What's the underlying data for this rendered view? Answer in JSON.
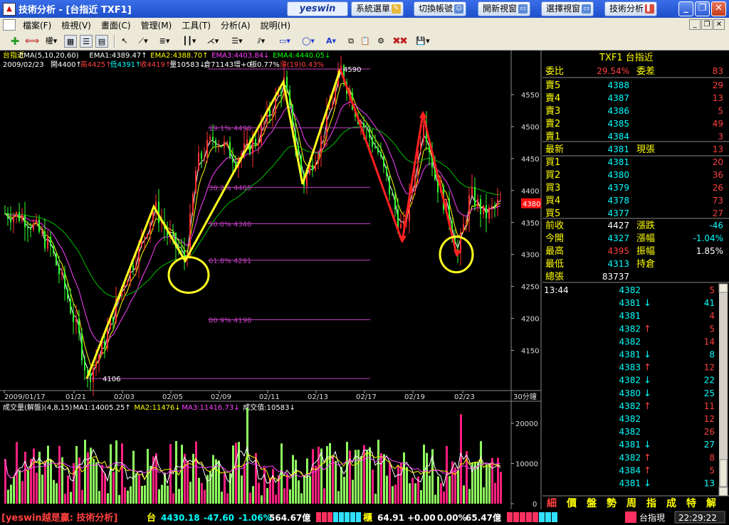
{
  "window": {
    "title": "技術分析 - [台指近 TXF1]",
    "logo": "yeswin",
    "buttons": [
      {
        "label": "系統選單"
      },
      {
        "label": "切換帳號"
      },
      {
        "label": "開新視窗"
      },
      {
        "label": "選擇視窗"
      },
      {
        "label": "技術分析"
      }
    ]
  },
  "menu": [
    "檔案(F)",
    "檢視(V)",
    "畫面(C)",
    "管理(M)",
    "工具(T)",
    "分析(A)",
    "說明(H)"
  ],
  "toolbar": {
    "weight_label": "權"
  },
  "legend": {
    "line1": [
      {
        "text": "台指近",
        "color": "#ffff00"
      },
      {
        "text": "EMA(5,10,20,60)",
        "color": "#ffffff"
      },
      {
        "text": "EMA1:4389.47↑",
        "color": "#ffffff"
      },
      {
        "text": "EMA2:4388.70↑",
        "color": "#ffff00"
      },
      {
        "text": "EMA3:4403.84↓",
        "color": "#ff40ff"
      },
      {
        "text": "EMA4:4440.05↓",
        "color": "#00ff00"
      }
    ],
    "line2": [
      {
        "text": "2009/02/23",
        "color": "#ffffff"
      },
      {
        "text": "開4400↑",
        "color": "#ffffff"
      },
      {
        "text": "高4425↑",
        "color": "#ff4040"
      },
      {
        "text": "低4391↑",
        "color": "#00ffff"
      },
      {
        "text": "收4419↑",
        "color": "#ff4040"
      },
      {
        "text": "量10583↓",
        "color": "#ffffff"
      },
      {
        "text": "倉71143",
        "color": "#ffffff"
      },
      {
        "text": "增+0",
        "color": "#ffffff"
      },
      {
        "text": "振0.77%",
        "color": "#ffffff"
      },
      {
        "text": "漲(19)0.43%",
        "color": "#ff4040"
      }
    ]
  },
  "price_axis": {
    "ticks": [
      4550,
      4500,
      4450,
      4400,
      4350,
      4300,
      4250,
      4200,
      4150
    ],
    "current": "4380"
  },
  "fib_levels": [
    {
      "label": "19.1% 4498",
      "value": 4498
    },
    {
      "label": "38.2% 4405",
      "value": 4405
    },
    {
      "label": "50.0% 4348",
      "value": 4348
    },
    {
      "label": "61.8% 4291",
      "value": 4291
    },
    {
      "label": "80.9% 4198",
      "value": 4198
    }
  ],
  "annotations": {
    "low": "4106",
    "high": "4590"
  },
  "dates": [
    "2009/01/17",
    "01/21",
    "02/03",
    "02/05",
    "02/09",
    "02/11",
    "02/13",
    "02/17",
    "02/19",
    "02/23"
  ],
  "period": "30分鐘",
  "volume_legend": [
    {
      "text": "成交量(解盤)(4,8,15)",
      "color": "#ffffff"
    },
    {
      "text": "MA1:14005.25↑",
      "color": "#ffffff"
    },
    {
      "text": "MA2:11476↓",
      "color": "#ffff00"
    },
    {
      "text": "MA3:11416.73↓",
      "color": "#ff40ff"
    },
    {
      "text": "成交值:10583↓",
      "color": "#ffffff"
    }
  ],
  "volume_axis": [
    "20000",
    "10000",
    "0"
  ],
  "quote": {
    "header": "TXF1 台指近",
    "ratio": {
      "k1": "委比",
      "v1": "29.54%",
      "k2": "委差",
      "v2": "83"
    },
    "asks": [
      {
        "label": "賣5",
        "price": "4388",
        "qty": "29"
      },
      {
        "label": "賣4",
        "price": "4387",
        "qty": "13"
      },
      {
        "label": "賣3",
        "price": "4386",
        "qty": "5"
      },
      {
        "label": "賣2",
        "price": "4385",
        "qty": "49"
      },
      {
        "label": "賣1",
        "price": "4384",
        "qty": "3"
      }
    ],
    "last": {
      "label": "最新",
      "price": "4381",
      "k": "現張",
      "qty": "13"
    },
    "bids": [
      {
        "label": "買1",
        "price": "4381",
        "qty": "20"
      },
      {
        "label": "買2",
        "price": "4380",
        "qty": "36"
      },
      {
        "label": "買3",
        "price": "4379",
        "qty": "26"
      },
      {
        "label": "買4",
        "price": "4378",
        "qty": "73"
      },
      {
        "label": "買5",
        "price": "4377",
        "qty": "27"
      }
    ],
    "stats": [
      {
        "k1": "前收",
        "v1": "4427",
        "k2": "漲跌",
        "v2": "-46"
      },
      {
        "k1": "今開",
        "v1": "4327",
        "k2": "漲幅",
        "v2": "-1.04%"
      },
      {
        "k1": "最高",
        "v1": "4395",
        "k2": "振幅",
        "v2": "1.85%"
      },
      {
        "k1": "最低",
        "v1": "4313",
        "k2": "持倉",
        "v2": ""
      },
      {
        "k1": "總張",
        "v1": "83737",
        "k2": "",
        "v2": ""
      }
    ]
  },
  "ticks": {
    "time": "13:44",
    "rows": [
      {
        "price": "4382",
        "arrow": "",
        "qty": "5"
      },
      {
        "price": "4381",
        "arrow": "↓",
        "qty": "41"
      },
      {
        "price": "4381",
        "arrow": "",
        "qty": "4"
      },
      {
        "price": "4382",
        "arrow": "↑",
        "qty": "5"
      },
      {
        "price": "4382",
        "arrow": "",
        "qty": "14"
      },
      {
        "price": "4381",
        "arrow": "↓",
        "qty": "8"
      },
      {
        "price": "4383",
        "arrow": "↑",
        "qty": "12"
      },
      {
        "price": "4382",
        "arrow": "↓",
        "qty": "22"
      },
      {
        "price": "4380",
        "arrow": "↓",
        "qty": "25"
      },
      {
        "price": "4382",
        "arrow": "↑",
        "qty": "11"
      },
      {
        "price": "4382",
        "arrow": "",
        "qty": "12"
      },
      {
        "price": "4382",
        "arrow": "",
        "qty": "26"
      },
      {
        "price": "4381",
        "arrow": "↓",
        "qty": "27"
      },
      {
        "price": "4382",
        "arrow": "↑",
        "qty": "8"
      },
      {
        "price": "4384",
        "arrow": "↑",
        "qty": "5"
      },
      {
        "price": "4381",
        "arrow": "↓",
        "qty": "13"
      }
    ]
  },
  "quote_tabs": [
    "細",
    "價",
    "盤",
    "勢",
    "周",
    "指",
    "成",
    "特",
    "解"
  ],
  "status": {
    "brand": "[yeswin越是贏: 技術分析]",
    "idx_label": "台",
    "idx_value": "4430.18",
    "idx_change": "-47.60",
    "idx_pct": "-1.06%",
    "idx_amount": "564.67億",
    "otc_label": "櫃",
    "otc_value": "64.91",
    "otc_change": "+0.00",
    "otc_pct": "0.00%",
    "otc_amount": "65.47億",
    "market": "台指現",
    "time": "22:29:22"
  },
  "colors": {
    "up": "#ff3030",
    "down": "#30ff30",
    "ema1": "#ffffff",
    "ema2": "#ffff00",
    "ema3": "#ff40ff",
    "ema4": "#00c000",
    "fib": "#c040c0",
    "bull_wave": "#ffff20",
    "bear_wave": "#ff2020"
  }
}
